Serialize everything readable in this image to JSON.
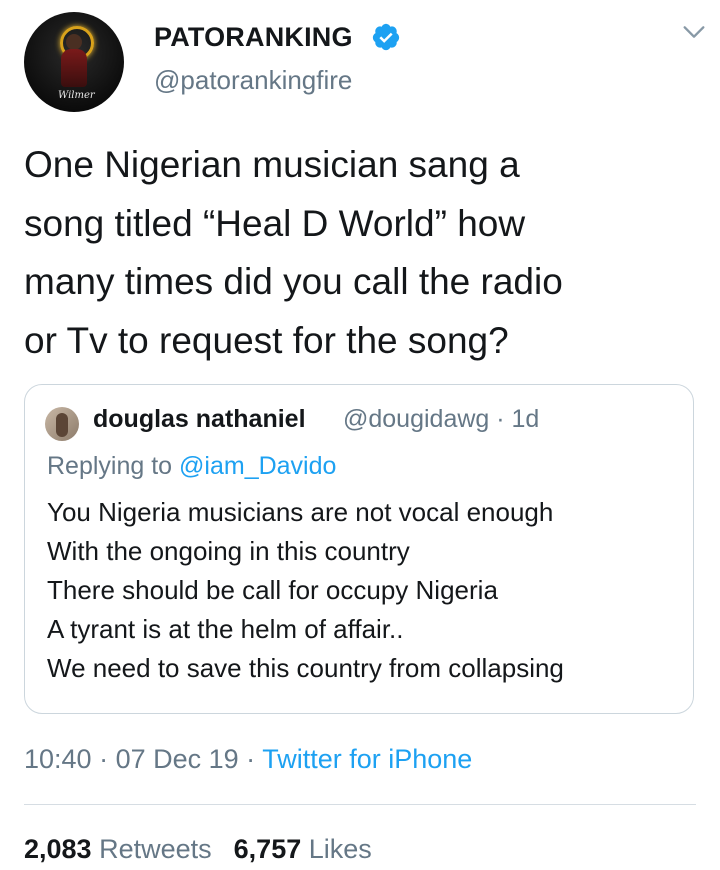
{
  "author": {
    "display_name": "PATORANKING",
    "handle": "@patorankingfire",
    "verified": true,
    "avatar_signature": "Wilmer",
    "avatar_icon": "profile-photo"
  },
  "tweet": {
    "text_lines": [
      "One Nigerian musician sang a",
      "song titled “Heal D World” how",
      "many times did you call the radio",
      "or Tv to request for the song?"
    ]
  },
  "quoted_tweet": {
    "display_name": "douglas nathaniel",
    "handle_time": "@dougidawg · 1d",
    "replying_prefix": "Replying to",
    "replying_to": "@iam_Davido",
    "text_lines": [
      "You Nigeria musicians are not vocal enough",
      "With the ongoing in this country",
      "There should be call for occupy Nigeria",
      "A tyrant is at the helm of affair..",
      "We need to save this country from collapsing"
    ]
  },
  "meta": {
    "time": "10:40",
    "separator": " · ",
    "date": "07 Dec 19",
    "source": "Twitter for iPhone"
  },
  "stats": {
    "retweets_count": "2,083",
    "retweets_label": "Retweets",
    "likes_count": "6,757",
    "likes_label": "Likes"
  },
  "colors": {
    "text": "#14171a",
    "secondary": "#657786",
    "accent": "#1da1f2",
    "border": "#ccd6dd",
    "verified_badge": "#1da1f2"
  }
}
